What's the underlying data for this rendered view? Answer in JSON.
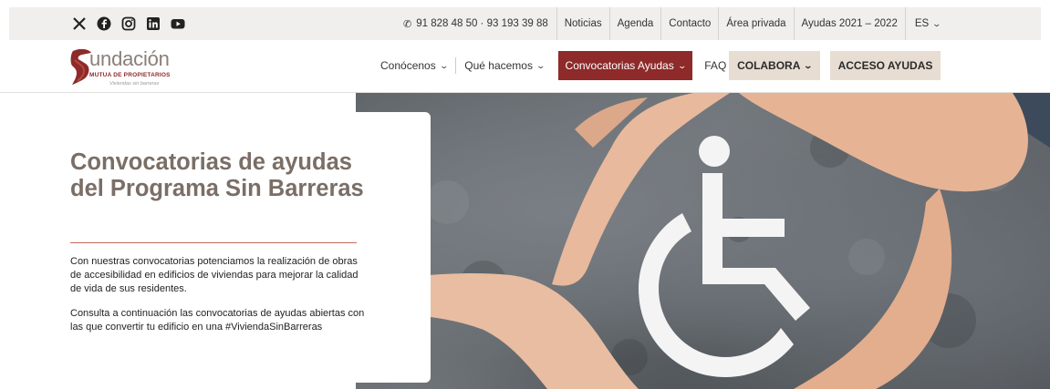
{
  "topbar": {
    "social": [
      {
        "name": "x-icon"
      },
      {
        "name": "facebook-icon"
      },
      {
        "name": "instagram-icon"
      },
      {
        "name": "linkedin-icon"
      },
      {
        "name": "youtube-icon"
      }
    ],
    "phone": "91 828 48 50 · 93 193 39 88",
    "links": [
      "Noticias",
      "Agenda",
      "Contacto",
      "Área privada",
      "Ayudas 2021 – 2022"
    ],
    "language": "ES"
  },
  "logo": {
    "title": "undación",
    "subtitle": "MUTUA DE PROPIETARIOS",
    "tagline": "Viviendas sin barreras"
  },
  "nav": {
    "items": [
      {
        "label": "Conócenos"
      },
      {
        "label": "Qué hacemos"
      },
      {
        "label": "Convocatorias Ayudas"
      },
      {
        "label": "FAQ"
      }
    ],
    "colabora": "COLABORA",
    "acceso": "ACCESO AYUDAS"
  },
  "hero": {
    "title": "Convocatorias de ayudas del Programa Sin Barreras",
    "paragraph1": "Con nuestras convocatorias potenciamos la realización de obras de accesibilidad en edificios de viviendas para mejorar la calidad de vida de sus residentes.",
    "paragraph2": "Consulta a continuación las convocatorias de ayudas abiertas con las que convertir tu edificio en una #ViviendaSinBarreras"
  },
  "colors": {
    "brand_red": "#8e2a2a",
    "brand_taupe": "#7a6e66",
    "button_beige": "#e7ddd3",
    "topbar_bg": "#f0efed"
  }
}
